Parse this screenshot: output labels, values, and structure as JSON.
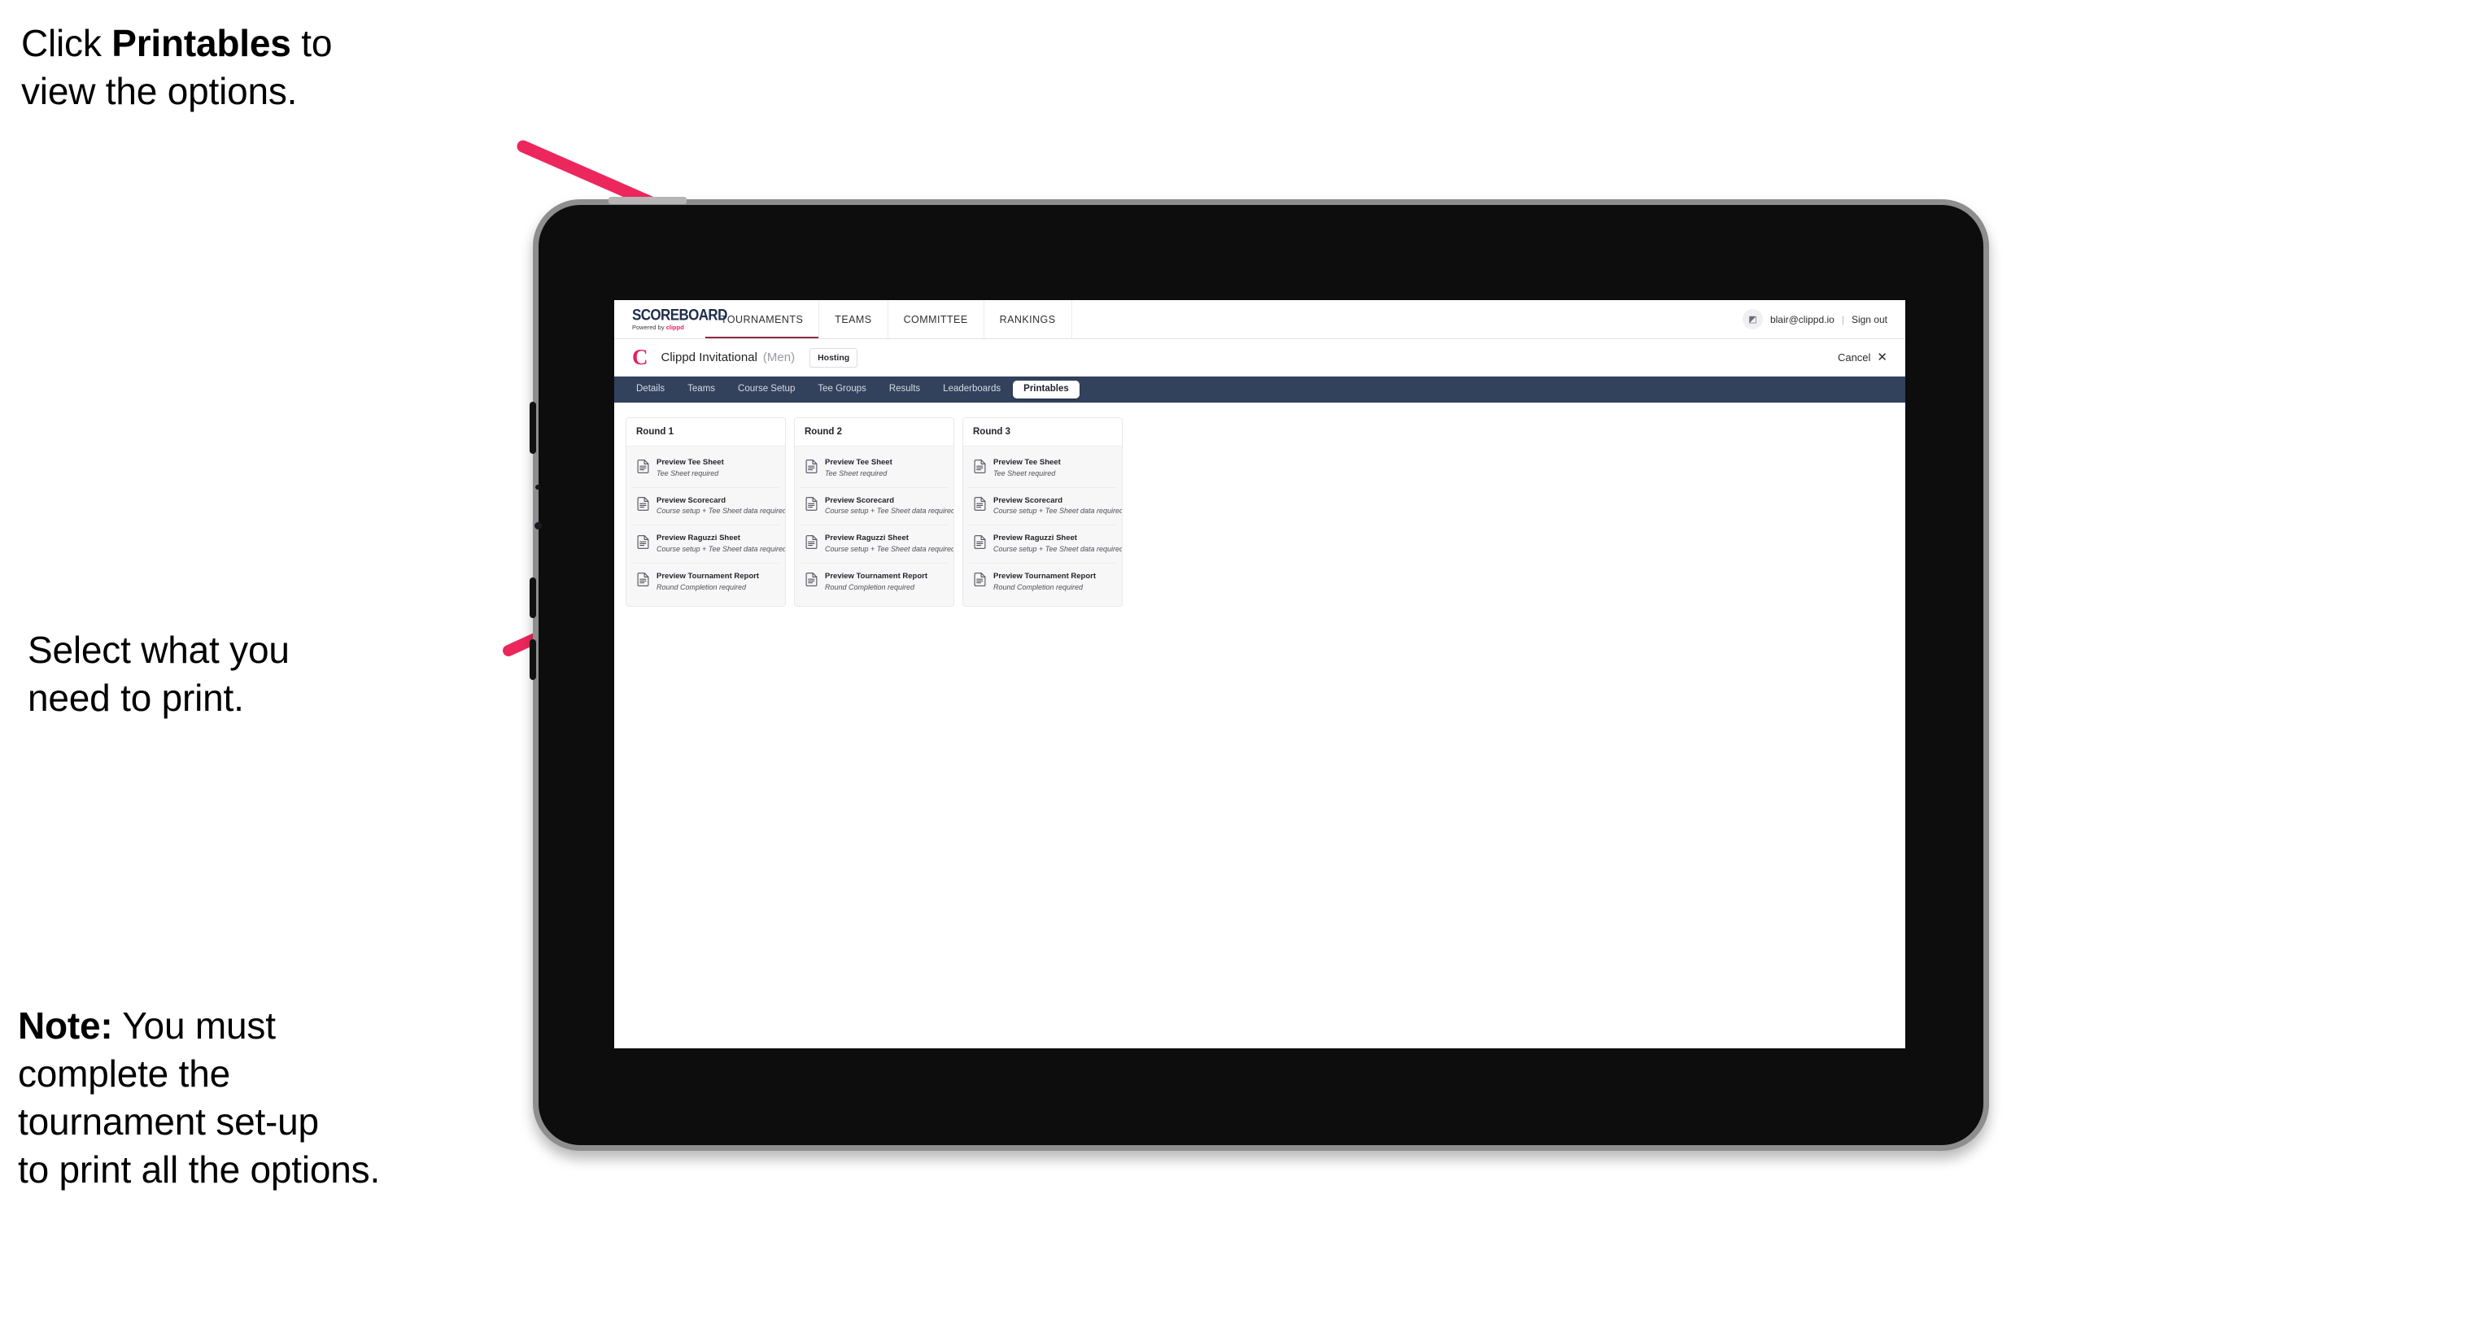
{
  "annotations": {
    "a1_pre": "Click ",
    "a1_bold": "Printables",
    "a1_post": " to\nview the options.",
    "a2": "Select what you\n need to print.",
    "a3_bold": "Note:",
    "a3_post": " You must\ncomplete the\ntournament set-up\nto print all the options.",
    "arrow_color": "#ec275e"
  },
  "browser": {
    "topnav": {
      "logo_word": "SCOREBOARD",
      "logo_sub_prefix": "Powered by ",
      "logo_sub_brand": "clippd",
      "items": [
        {
          "label": "TOURNAMENTS",
          "active": true
        },
        {
          "label": "TEAMS",
          "active": false
        },
        {
          "label": "COMMITTEE",
          "active": false
        },
        {
          "label": "RANKINGS",
          "active": false
        }
      ],
      "avatar_glyph": "◩",
      "email": "blair@clippd.io",
      "separator": "|",
      "sign_out": "Sign out"
    },
    "tournament_bar": {
      "logo_letter": "C",
      "name": "Clippd Invitational",
      "gender": "(Men)",
      "chip": "Hosting",
      "cancel_label": "Cancel",
      "cancel_icon": "✕"
    },
    "tabs": [
      {
        "label": "Details",
        "active": false
      },
      {
        "label": "Teams",
        "active": false
      },
      {
        "label": "Course Setup",
        "active": false
      },
      {
        "label": "Tee Groups",
        "active": false
      },
      {
        "label": "Results",
        "active": false
      },
      {
        "label": "Leaderboards",
        "active": false
      },
      {
        "label": "Printables",
        "active": true
      }
    ],
    "rounds": [
      {
        "title": "Round 1",
        "items": [
          {
            "title": "Preview Tee Sheet",
            "sub": "Tee Sheet required"
          },
          {
            "title": "Preview Scorecard",
            "sub": "Course setup + Tee Sheet data required"
          },
          {
            "title": "Preview Raguzzi Sheet",
            "sub": "Course setup + Tee Sheet data required"
          },
          {
            "title": "Preview Tournament Report",
            "sub": "Round Completion required"
          }
        ]
      },
      {
        "title": "Round 2",
        "items": [
          {
            "title": "Preview Tee Sheet",
            "sub": "Tee Sheet required"
          },
          {
            "title": "Preview Scorecard",
            "sub": "Course setup + Tee Sheet data required"
          },
          {
            "title": "Preview Raguzzi Sheet",
            "sub": "Course setup + Tee Sheet data required"
          },
          {
            "title": "Preview Tournament Report",
            "sub": "Round Completion required"
          }
        ]
      },
      {
        "title": "Round 3",
        "items": [
          {
            "title": "Preview Tee Sheet",
            "sub": "Tee Sheet required"
          },
          {
            "title": "Preview Scorecard",
            "sub": "Course setup + Tee Sheet data required"
          },
          {
            "title": "Preview Raguzzi Sheet",
            "sub": "Course setup + Tee Sheet data required"
          },
          {
            "title": "Preview Tournament Report",
            "sub": "Round Completion required"
          }
        ]
      }
    ]
  },
  "colors": {
    "accent_pink": "#e3215b",
    "tabstrip_navy": "#32415c",
    "annotation_arrow": "#ec275e"
  }
}
